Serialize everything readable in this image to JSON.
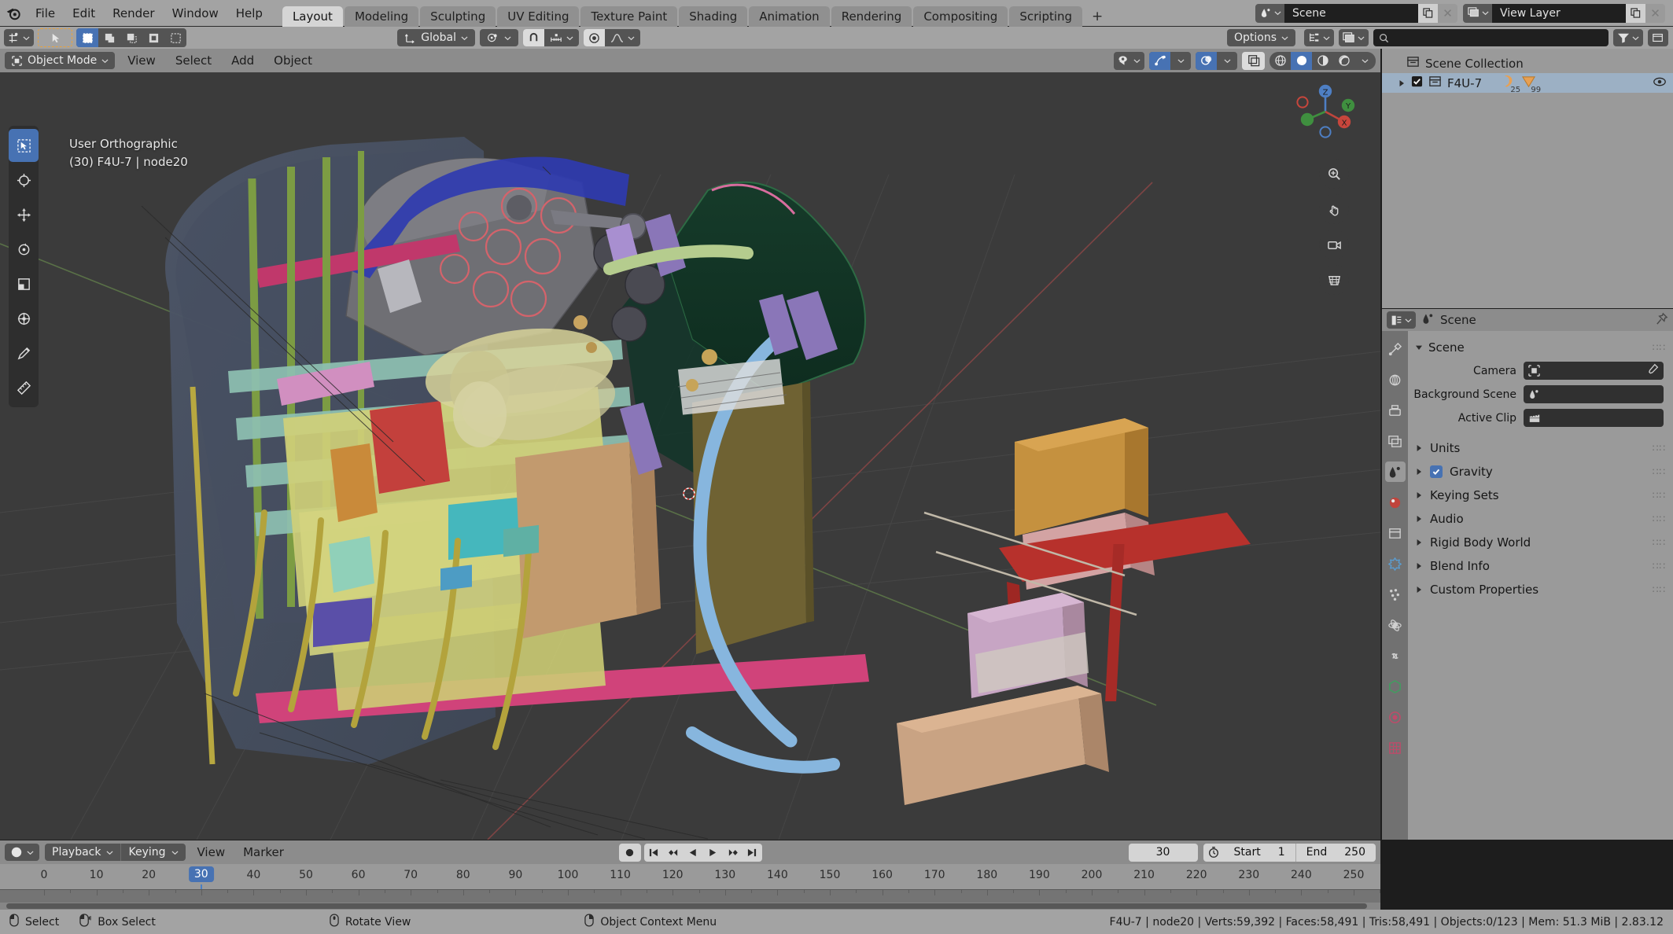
{
  "app": {
    "name": "Blender",
    "version": "2.83.12"
  },
  "topbar": {
    "logo_icon": "blender-logo-icon",
    "menus": [
      "File",
      "Edit",
      "Render",
      "Window",
      "Help"
    ],
    "workspace_tabs": [
      {
        "label": "Layout",
        "active": true
      },
      {
        "label": "Modeling",
        "active": false
      },
      {
        "label": "Sculpting",
        "active": false
      },
      {
        "label": "UV Editing",
        "active": false
      },
      {
        "label": "Texture Paint",
        "active": false
      },
      {
        "label": "Shading",
        "active": false
      },
      {
        "label": "Animation",
        "active": false
      },
      {
        "label": "Rendering",
        "active": false
      },
      {
        "label": "Compositing",
        "active": false
      },
      {
        "label": "Scripting",
        "active": false
      }
    ],
    "add_workspace_label": "+",
    "scene_selector": {
      "icon": "scene-icon",
      "value": "Scene",
      "copy_icon": "duplicate-icon",
      "close_icon": "close-icon"
    },
    "view_layer_selector": {
      "icon": "view-layer-icon",
      "value": "View Layer",
      "copy_icon": "duplicate-icon",
      "close_icon": "close-icon"
    }
  },
  "toolsettings": {
    "editor_type_icon": "editor-type-icon",
    "active_tool_icon": "tweak-tool-icon",
    "select_modes": [
      {
        "icon": "select-set-icon",
        "active": true
      },
      {
        "icon": "select-extend-icon",
        "active": false
      },
      {
        "icon": "select-subtract-icon",
        "active": false
      },
      {
        "icon": "select-invert-icon",
        "active": false
      },
      {
        "icon": "select-intersect-icon",
        "active": false
      }
    ],
    "transform_orientation": {
      "icon": "orientation-icon",
      "value": "Global"
    },
    "pivot_point_icon": "pivot-point-icon",
    "snap_magnet_icon": "magnet-icon",
    "snap_target_icon": "snap-increment-icon",
    "proportional_edit_icon": "proportional-edit-icon",
    "proportional_falloff_icon": "falloff-smooth-icon",
    "options_label": "Options"
  },
  "viewport": {
    "mode": "Object Mode",
    "mode_icon": "object-mode-icon",
    "menus": [
      "View",
      "Select",
      "Add",
      "Object"
    ],
    "overlay_text_line1": "User Orthographic",
    "overlay_text_line2": "(30) F4U-7 | node20",
    "header_right": {
      "visibility_icon": "object-visibility-icon",
      "gizmo_icon": "gizmo-icon",
      "overlays_icon": "overlays-icon",
      "xray_icon": "xray-icon",
      "shading_modes": [
        {
          "icon": "shading-wireframe-icon",
          "active": false
        },
        {
          "icon": "shading-solid-icon",
          "active": true
        },
        {
          "icon": "shading-material-icon",
          "active": false
        },
        {
          "icon": "shading-rendered-icon",
          "active": false
        }
      ]
    },
    "toolbar": [
      {
        "icon": "tweak-select-box-icon",
        "active": true
      },
      {
        "icon": "cursor-tool-icon",
        "active": false
      },
      {
        "icon": "move-tool-icon",
        "active": false
      },
      {
        "icon": "rotate-tool-icon",
        "active": false
      },
      {
        "icon": "scale-tool-icon",
        "active": false
      },
      {
        "icon": "transform-tool-icon",
        "active": false
      },
      {
        "icon": "annotate-tool-icon",
        "active": false
      },
      {
        "icon": "measure-tool-icon",
        "active": false
      }
    ],
    "nav_gizmo": {
      "axis_x": "X",
      "axis_y": "Y",
      "axis_z": "Z"
    },
    "nav_buttons": [
      {
        "icon": "zoom-nav-icon"
      },
      {
        "icon": "pan-nav-icon"
      },
      {
        "icon": "camera-nav-icon"
      },
      {
        "icon": "ortho-persp-nav-icon"
      }
    ],
    "cursor_3d_icon": "3d-cursor-icon"
  },
  "outliner": {
    "editor_icon": "outliner-icon",
    "display_mode_icon": "view-layer-display-icon",
    "filter_icon": "filter-icon",
    "new_collection_icon": "new-collection-icon",
    "search_placeholder": "",
    "search_icon": "search-icon",
    "rows": [
      {
        "label": "Scene Collection",
        "icon": "collection-icon",
        "indent": 0,
        "selected": false,
        "has_disclosure": false,
        "has_checkbox": false,
        "badges": [],
        "eye": false
      },
      {
        "label": "F4U-7",
        "icon": "collection-icon",
        "indent": 1,
        "selected": true,
        "has_disclosure": true,
        "has_checkbox": true,
        "badges": [
          {
            "icon": "armature-badge-icon",
            "count": "25"
          },
          {
            "icon": "mesh-badge-icon",
            "count": "99"
          }
        ],
        "eye": true
      }
    ]
  },
  "properties": {
    "editor_icon": "properties-icon",
    "breadcrumb_icon": "scene-props-icon",
    "breadcrumb_label": "Scene",
    "pin_icon": "pin-icon",
    "tabs": [
      {
        "icon": "tool-tab-icon",
        "name": "tool",
        "active": false
      },
      {
        "icon": "render-tab-icon",
        "name": "render",
        "active": false
      },
      {
        "icon": "output-tab-icon",
        "name": "output",
        "active": false
      },
      {
        "icon": "view-layer-tab-icon",
        "name": "view-layer",
        "active": false
      },
      {
        "icon": "scene-tab-icon",
        "name": "scene",
        "active": true
      },
      {
        "icon": "world-tab-icon",
        "name": "world",
        "active": false
      },
      {
        "icon": "collection-tab-icon",
        "name": "collection",
        "active": false
      },
      {
        "icon": "modifier-tab-icon",
        "name": "modifier",
        "active": false
      },
      {
        "icon": "particles-tab-icon",
        "name": "particles",
        "active": false
      },
      {
        "icon": "physics-tab-icon",
        "name": "physics",
        "active": false
      },
      {
        "icon": "constraints-tab-icon",
        "name": "constraints",
        "active": false
      },
      {
        "icon": "data-tab-icon",
        "name": "data",
        "active": false
      },
      {
        "icon": "material-tab-icon",
        "name": "material",
        "active": false
      },
      {
        "icon": "texture-tab-icon",
        "name": "texture",
        "active": false
      }
    ],
    "panel_title": "Scene",
    "fields": [
      {
        "label": "Camera",
        "icon": "camera-field-icon",
        "value": "",
        "has_eyedropper": true
      },
      {
        "label": "Background Scene",
        "icon": "scene-field-icon",
        "value": "",
        "has_eyedropper": false
      },
      {
        "label": "Active Clip",
        "icon": "clip-field-icon",
        "value": "",
        "has_eyedropper": false
      }
    ],
    "sections": [
      {
        "label": "Units",
        "checkbox": null
      },
      {
        "label": "Gravity",
        "checkbox": true
      },
      {
        "label": "Keying Sets",
        "checkbox": null
      },
      {
        "label": "Audio",
        "checkbox": null
      },
      {
        "label": "Rigid Body World",
        "checkbox": null
      },
      {
        "label": "Blend Info",
        "checkbox": null
      },
      {
        "label": "Custom Properties",
        "checkbox": null
      }
    ]
  },
  "timeline": {
    "editor_icon": "timeline-icon",
    "playback_label": "Playback",
    "keying_label": "Keying",
    "menus": [
      "View",
      "Marker"
    ],
    "transport": {
      "record_icon": "record-icon",
      "jump_start_icon": "jump-to-start-icon",
      "prev_keyframe_icon": "prev-keyframe-icon",
      "play_reverse_icon": "play-reverse-icon",
      "play_icon": "play-icon",
      "next_keyframe_icon": "next-keyframe-icon",
      "jump_end_icon": "jump-to-end-icon"
    },
    "current_frame": "30",
    "use_preview_range_icon": "stopwatch-icon",
    "start_label": "Start",
    "start_value": "1",
    "end_label": "End",
    "end_value": "250",
    "ruler_ticks": [
      "0",
      "10",
      "20",
      "30",
      "40",
      "50",
      "60",
      "70",
      "80",
      "90",
      "100",
      "110",
      "120",
      "130",
      "140",
      "150",
      "160",
      "170",
      "180",
      "190",
      "200",
      "210",
      "220",
      "230",
      "240",
      "250"
    ],
    "playhead_frame": "30"
  },
  "statusbar": {
    "hints": [
      {
        "icon": "mouse-left-icon",
        "label": "Select"
      },
      {
        "icon": "mouse-left-drag-icon",
        "label": "Box Select"
      },
      {
        "icon": "mouse-middle-icon",
        "label": "Rotate View"
      },
      {
        "icon": "mouse-right-icon",
        "label": "Object Context Menu"
      }
    ],
    "stats": "F4U-7 | node20 | Verts:59,392 | Faces:58,491 | Tris:58,491 | Objects:0/123 | Mem: 51.3 MiB | 2.83.12"
  },
  "colors": {
    "accent_blue": "#4772b3",
    "header_gray": "#a3a3a3",
    "viewport_bg": "#3b3b3b",
    "panel_gray": "#9a9a9a",
    "field_dark": "#1f1f1f",
    "active_tool_orange": "#e8a23d"
  }
}
